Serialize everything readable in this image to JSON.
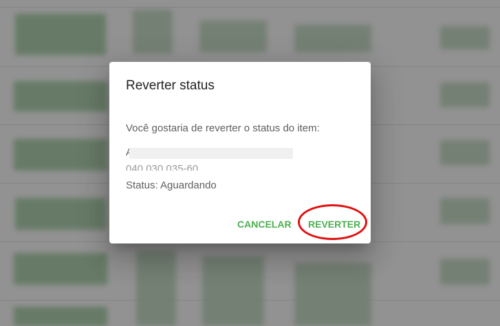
{
  "dialog": {
    "title": "Reverter status",
    "question": "Você gostaria de reverter o status do item:",
    "item_line_1": "A                                        A",
    "item_line_2": "040.030.035-60",
    "status_text": "Status: Aguardando",
    "cancel_label": "CANCELAR",
    "revert_label": "REVERTER"
  },
  "colors": {
    "accent": "#4caf50",
    "highlight": "#e20f0f"
  }
}
